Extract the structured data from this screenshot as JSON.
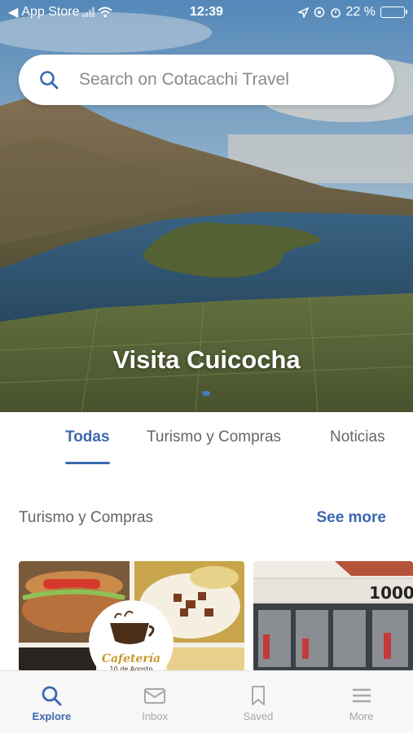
{
  "status_bar": {
    "back_app": "App Store",
    "time": "12:39",
    "battery": "22 %",
    "battery_level": 0.22
  },
  "search": {
    "placeholder": "Search on Cotacachi Travel",
    "icon": "search-icon"
  },
  "hero": {
    "title": "Visita Cuicocha",
    "carousel_active_index": 0
  },
  "tabs": [
    {
      "label": "Todas",
      "active": true
    },
    {
      "label": "Turismo y Compras",
      "active": false
    },
    {
      "label": "Noticias",
      "active": false
    }
  ],
  "section": {
    "title": "Turismo y Compras",
    "see_more": "See more"
  },
  "cards": [
    {
      "logo_name": "Cafetería",
      "logo_sub": "10 de Agosto"
    },
    {
      "sign_text": "1000"
    }
  ],
  "bottom_nav": [
    {
      "label": "Explore",
      "icon": "search-icon",
      "active": true
    },
    {
      "label": "Inbox",
      "icon": "mail-icon",
      "active": false
    },
    {
      "label": "Saved",
      "icon": "bookmark-icon",
      "active": false
    },
    {
      "label": "More",
      "icon": "menu-icon",
      "active": false
    }
  ],
  "colors": {
    "accent": "#3b68b0",
    "inactive": "#a8a8a8"
  }
}
